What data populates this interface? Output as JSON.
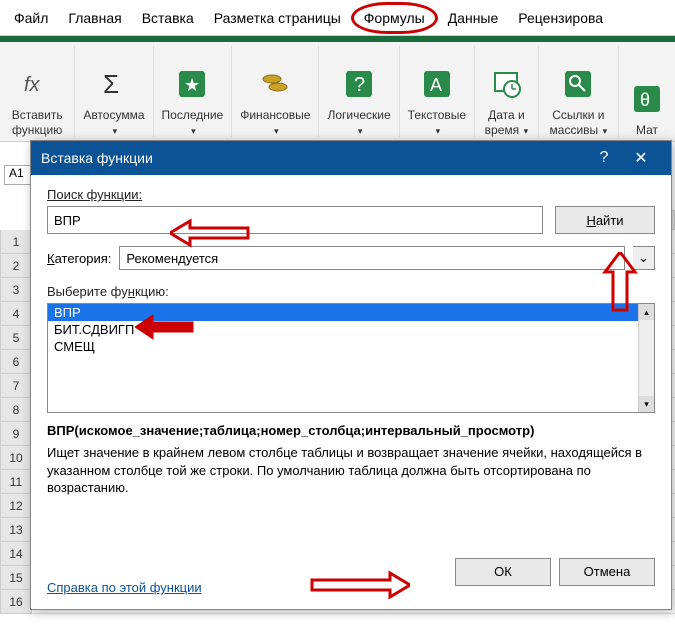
{
  "menu": {
    "items": [
      "Файл",
      "Главная",
      "Вставка",
      "Разметка страницы",
      "Формулы",
      "Данные",
      "Рецензирова"
    ],
    "activeIndex": 4
  },
  "ribbon": {
    "insertFn": "Вставить функцию",
    "autosum": "Автосумма",
    "recent": "Последние",
    "financial": "Финансовые",
    "logical": "Логические",
    "text": "Текстовые",
    "date": "Дата и время",
    "lookup": "Ссылки и массивы",
    "math": "Мат"
  },
  "namebox": "A1",
  "rows": [
    "1",
    "2",
    "3",
    "4",
    "5",
    "6",
    "7",
    "8",
    "9",
    "10",
    "11",
    "12",
    "13",
    "14",
    "15",
    "16"
  ],
  "dialog": {
    "title": "Вставка функции",
    "searchLabel": "Поиск функции:",
    "searchValue": "ВПР",
    "findBtn": "Найти",
    "categoryLabel": "Категория:",
    "categoryValue": "Рекомендуется",
    "selectLabel": "Выберите функцию:",
    "functions": [
      "ВПР",
      "БИТ.СДВИГП",
      "СМЕЩ"
    ],
    "selectedIndex": 0,
    "signature": "ВПР(искомое_значение;таблица;номер_столбца;интервальный_просмотр)",
    "description": "Ищет значение в крайнем левом столбце таблицы и возвращает значение ячейки, находящейся в указанном столбце той же строки. По умолчанию таблица должна быть отсортирована по возрастанию.",
    "helpLink": "Справка по этой функции",
    "ok": "ОК",
    "cancel": "Отмена"
  }
}
